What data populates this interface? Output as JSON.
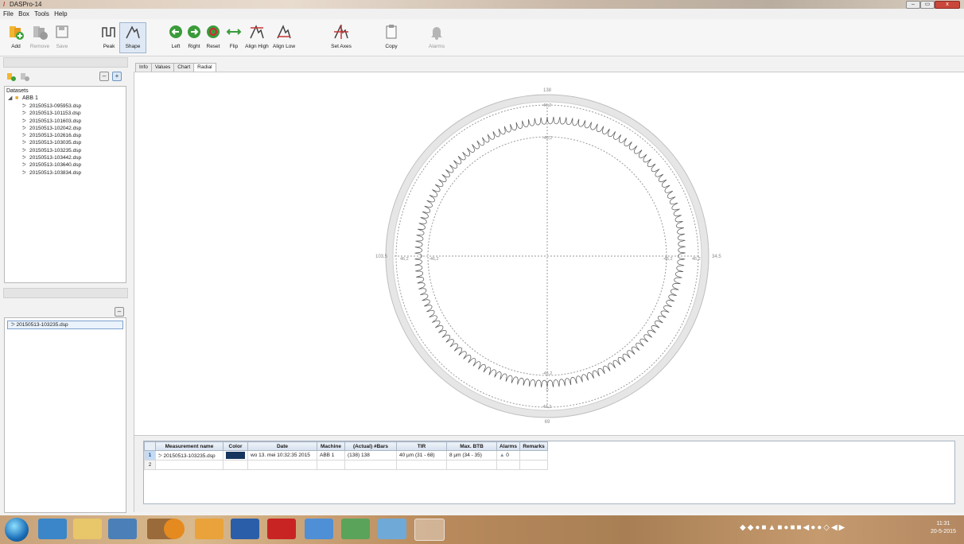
{
  "window": {
    "title": "DASPro-14",
    "min": "–",
    "max": "▭",
    "close": "x"
  },
  "menu": [
    "File",
    "Box",
    "Tools",
    "Help"
  ],
  "ribbon": {
    "add": "Add",
    "remove": "Remove",
    "save": "Save",
    "peak": "Peak",
    "shape": "Shape",
    "left": "Left",
    "right": "Right",
    "reset": "Reset",
    "flip": "Flip",
    "align_high": "Align High",
    "align_low": "Align Low",
    "set_axes": "Set Axes",
    "copy": "Copy",
    "alarms": "Alarms"
  },
  "datasets": {
    "header": "Datasets",
    "root": "ABB 1",
    "files": [
      "20150513-095953.dsp",
      "20150513-101153.dsp",
      "20150513-101603.dsp",
      "20150513-102042.dsp",
      "20150513-102616.dsp",
      "20150513-103035.dsp",
      "20150513-103235.dsp",
      "20150513-103442.dsp",
      "20150513-103640.dsp",
      "20150513-103834.dsp"
    ]
  },
  "selected_measurement": "20150513-103235.dsp",
  "tabs": [
    "Info",
    "Values",
    "Chart",
    "Radial"
  ],
  "active_tab": "Radial",
  "radial": {
    "label_top": "138",
    "label_bottom": "69",
    "label_left": "103,5",
    "label_right": "34,5",
    "ring_value_outer": "46,2",
    "ring_value_inner": "-46,2",
    "ring_value_center": "0",
    "series_bars": 138,
    "series_color": "#555555"
  },
  "table": {
    "headers": [
      "Measurement name",
      "Color",
      "Date",
      "Machine",
      "(Actual) #Bars",
      "TIR",
      "Max. BTB",
      "Alarms",
      "Remarks"
    ],
    "rows": [
      {
        "num": "1",
        "name": "20150513-103235.dsp",
        "color": "#17365d",
        "date": "wo 13. mei 10:32:35 2015",
        "machine": "ABB 1",
        "bars": "(138) 138",
        "tir": "40 µm (31 - 68)",
        "btb": "8 µm (34 - 35)",
        "alarms": "0",
        "remarks": ""
      },
      {
        "num": "2",
        "name": "",
        "color": "",
        "date": "",
        "machine": "",
        "bars": "",
        "tir": "",
        "btb": "",
        "alarms": "",
        "remarks": ""
      }
    ]
  },
  "taskbar": {
    "time": "11:31",
    "date": "20-5-2015"
  }
}
